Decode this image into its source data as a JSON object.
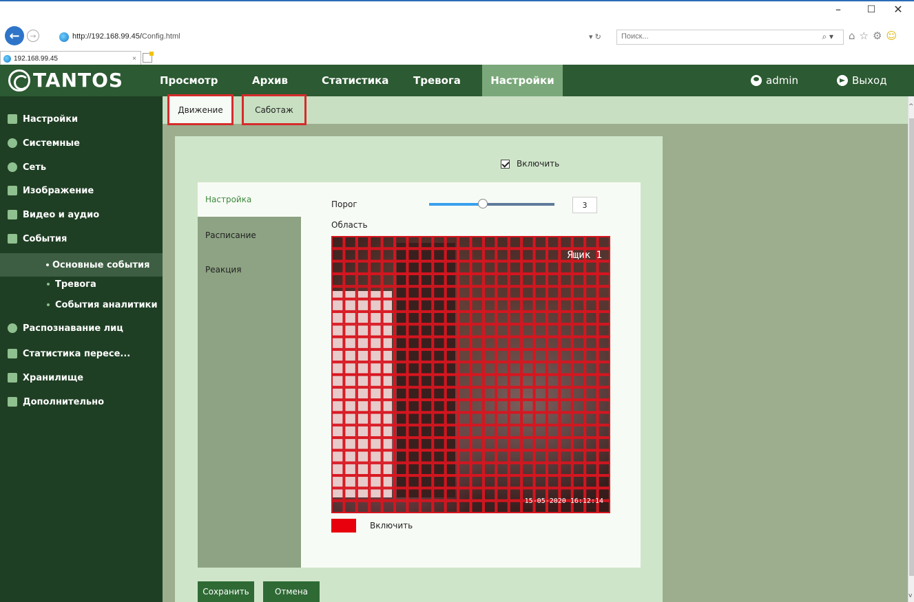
{
  "browser": {
    "url_prefix": "http://192.168.99.45/",
    "url_path": "Config.html",
    "refresh": "▾ ↻",
    "search_placeholder": "Поиск...",
    "search_dropdown": "⌕ ▾",
    "tab_title": "192.168.99.45",
    "tab_close": "×",
    "icons": [
      "home-icon",
      "favorites-icon",
      "settings-icon",
      "smiley-icon"
    ]
  },
  "header": {
    "logo": "TANTOS",
    "nav": [
      "Просмотр",
      "Архив",
      "Статистика",
      "Тревога",
      "Настройки"
    ],
    "active_nav": "Настройки",
    "user": "admin",
    "logout": "Выход"
  },
  "sidebar": {
    "items": [
      {
        "label": "Настройки",
        "icon": "settings-panel-icon"
      },
      {
        "label": "Системные",
        "icon": "info-icon"
      },
      {
        "label": "Сеть",
        "icon": "globe-icon"
      },
      {
        "label": "Изображение",
        "icon": "image-icon"
      },
      {
        "label": "Видео и аудио",
        "icon": "video-icon"
      },
      {
        "label": "События",
        "icon": "bell-icon"
      },
      {
        "label": "Основные события",
        "sub": true,
        "active": true
      },
      {
        "label": "Тревога",
        "sub": true
      },
      {
        "label": "События аналитики",
        "sub": true
      },
      {
        "label": "Распознавание лиц",
        "icon": "face-icon"
      },
      {
        "label": "Статистика пересе...",
        "icon": "bar-chart-icon"
      },
      {
        "label": "Хранилище",
        "icon": "storage-icon"
      },
      {
        "label": "Дополнительно",
        "icon": "tools-icon"
      }
    ]
  },
  "subtabs": {
    "motion": "Движение",
    "sabotage": "Саботаж"
  },
  "panel": {
    "enable_label": "Включить",
    "enable_checked": true,
    "inner_tabs": [
      "Настройка",
      "Расписание",
      "Реакция"
    ],
    "threshold_label": "Порог",
    "threshold_value": "3",
    "threshold_fraction": 0.43,
    "area_label": "Область",
    "osd_name": "Ящик 1",
    "osd_time": "15-05-2020 16:12:14",
    "grid_color": "#d8151f",
    "grid_cols": 22,
    "grid_rows": 22,
    "swatch_color": "#e8000c",
    "area_enable_label": "Включить",
    "save": "Сохранить",
    "cancel": "Отмена"
  },
  "window_controls": {
    "minimize": "–",
    "maximize": "☐",
    "close": "✕"
  }
}
